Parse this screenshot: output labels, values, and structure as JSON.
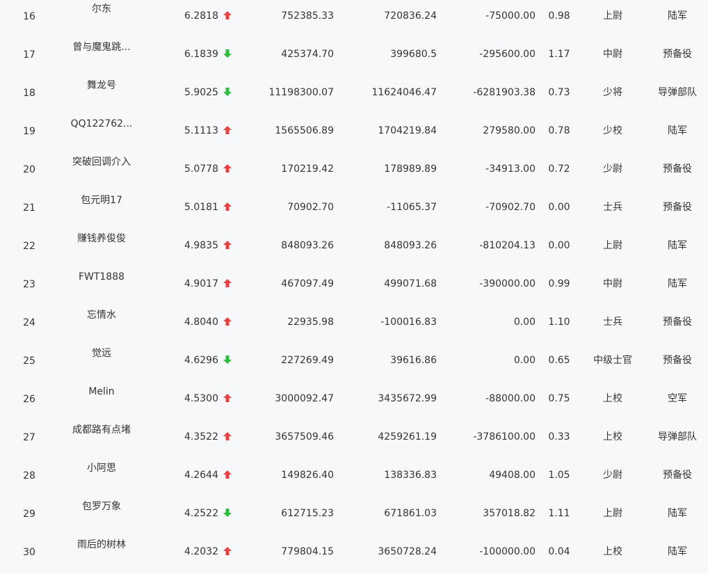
{
  "colors": {
    "background": "#f7f8fa",
    "text": "#333333",
    "up": "#e94242",
    "down": "#2dbd3c"
  },
  "rows": [
    {
      "rank": "16",
      "name": "尔东",
      "ratio": "6.2818",
      "trend": "up",
      "v1": "752385.33",
      "v2": "720836.24",
      "v3": "-75000.00",
      "pct": "0.98",
      "military_rank": "上尉",
      "branch": "陆军"
    },
    {
      "rank": "17",
      "name": "曾与魔鬼跳...",
      "ratio": "6.1839",
      "trend": "down",
      "v1": "425374.70",
      "v2": "399680.5",
      "v3": "-295600.00",
      "pct": "1.17",
      "military_rank": "中尉",
      "branch": "预备役"
    },
    {
      "rank": "18",
      "name": "舞龙号",
      "ratio": "5.9025",
      "trend": "down",
      "v1": "11198300.07",
      "v2": "11624046.47",
      "v3": "-6281903.38",
      "pct": "0.73",
      "military_rank": "少将",
      "branch": "导弹部队"
    },
    {
      "rank": "19",
      "name": "QQ122762...",
      "ratio": "5.1113",
      "trend": "up",
      "v1": "1565506.89",
      "v2": "1704219.84",
      "v3": "279580.00",
      "pct": "0.78",
      "military_rank": "少校",
      "branch": "陆军"
    },
    {
      "rank": "20",
      "name": "突破回调介入",
      "ratio": "5.0778",
      "trend": "up",
      "v1": "170219.42",
      "v2": "178989.89",
      "v3": "-34913.00",
      "pct": "0.72",
      "military_rank": "少尉",
      "branch": "预备役"
    },
    {
      "rank": "21",
      "name": "包元明17",
      "ratio": "5.0181",
      "trend": "up",
      "v1": "70902.70",
      "v2": "-11065.37",
      "v3": "-70902.70",
      "pct": "0.00",
      "military_rank": "士兵",
      "branch": "预备役"
    },
    {
      "rank": "22",
      "name": "赚钱养俊俊",
      "ratio": "4.9835",
      "trend": "up",
      "v1": "848093.26",
      "v2": "848093.26",
      "v3": "-810204.13",
      "pct": "0.00",
      "military_rank": "上尉",
      "branch": "陆军"
    },
    {
      "rank": "23",
      "name": "FWT1888",
      "ratio": "4.9017",
      "trend": "up",
      "v1": "467097.49",
      "v2": "499071.68",
      "v3": "-390000.00",
      "pct": "0.99",
      "military_rank": "中尉",
      "branch": "陆军"
    },
    {
      "rank": "24",
      "name": "忘情水",
      "ratio": "4.8040",
      "trend": "up",
      "v1": "22935.98",
      "v2": "-100016.83",
      "v3": "0.00",
      "pct": "1.10",
      "military_rank": "士兵",
      "branch": "预备役"
    },
    {
      "rank": "25",
      "name": "觉远",
      "ratio": "4.6296",
      "trend": "down",
      "v1": "227269.49",
      "v2": "39616.86",
      "v3": "0.00",
      "pct": "0.65",
      "military_rank": "中级士官",
      "branch": "预备役"
    },
    {
      "rank": "26",
      "name": "Melin",
      "ratio": "4.5300",
      "trend": "up",
      "v1": "3000092.47",
      "v2": "3435672.99",
      "v3": "-88000.00",
      "pct": "0.75",
      "military_rank": "上校",
      "branch": "空军"
    },
    {
      "rank": "27",
      "name": "成都路有点堵",
      "ratio": "4.3522",
      "trend": "up",
      "v1": "3657509.46",
      "v2": "4259261.19",
      "v3": "-3786100.00",
      "pct": "0.33",
      "military_rank": "上校",
      "branch": "导弹部队"
    },
    {
      "rank": "28",
      "name": "小阿思",
      "ratio": "4.2644",
      "trend": "up",
      "v1": "149826.40",
      "v2": "138336.83",
      "v3": "49408.00",
      "pct": "1.05",
      "military_rank": "少尉",
      "branch": "预备役"
    },
    {
      "rank": "29",
      "name": "包罗万象",
      "ratio": "4.2522",
      "trend": "down",
      "v1": "612715.23",
      "v2": "671861.03",
      "v3": "357018.82",
      "pct": "1.11",
      "military_rank": "上尉",
      "branch": "陆军"
    },
    {
      "rank": "30",
      "name": "雨后的树林",
      "ratio": "4.2032",
      "trend": "up",
      "v1": "779804.15",
      "v2": "3650728.24",
      "v3": "-100000.00",
      "pct": "0.04",
      "military_rank": "上校",
      "branch": "陆军"
    }
  ]
}
